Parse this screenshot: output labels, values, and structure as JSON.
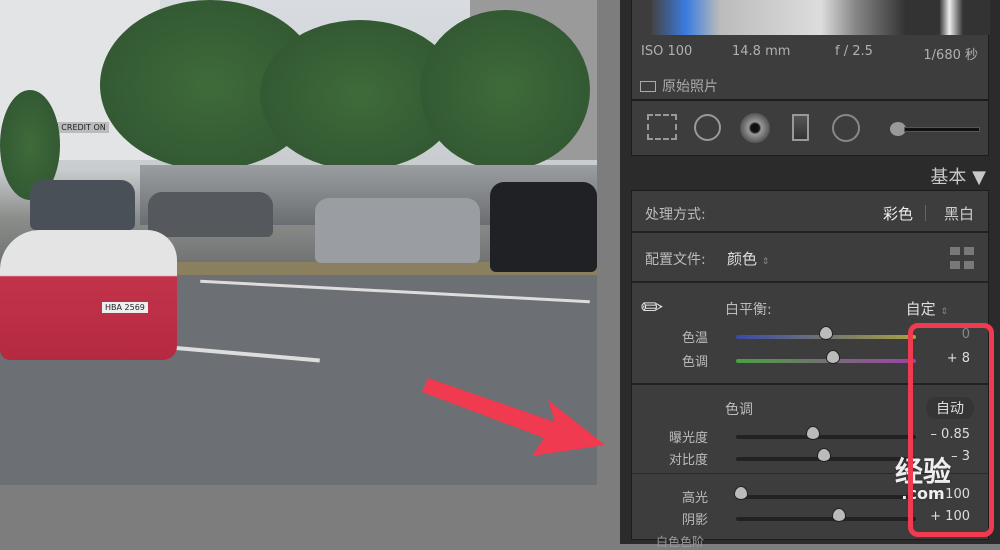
{
  "exif": {
    "iso": "ISO 100",
    "focal": "14.8 mm",
    "aperture": "f / 2.5",
    "shutter": "1/680 秒"
  },
  "original_photo_label": "原始照片",
  "section_title": "基本",
  "treatment": {
    "label": "处理方式:",
    "color": "彩色",
    "bw": "黑白"
  },
  "profile": {
    "label": "配置文件:",
    "value": "颜色"
  },
  "white_balance": {
    "label": "白平衡:",
    "value": "自定"
  },
  "sliders_wb": [
    {
      "label": "色温",
      "value": "0",
      "pos": 0.5
    },
    {
      "label": "色调",
      "value": "+ 8",
      "pos": 0.54
    }
  ],
  "tone": {
    "label": "色调",
    "auto": "自动"
  },
  "sliders_tone": [
    {
      "label": "曝光度",
      "value": "– 0.85",
      "pos": 0.43
    },
    {
      "label": "对比度",
      "value": "– 3",
      "pos": 0.49
    }
  ],
  "sliders_presence": [
    {
      "label": "高光",
      "value": "– 100",
      "pos": 0.0
    },
    {
      "label": "阴影",
      "value": "+ 100",
      "pos": 0.57
    }
  ],
  "next_slider_label": "白色色阶",
  "car_plate": "HBA 2569",
  "building_sign": "YAH CREDIT ON",
  "watermark": {
    "line1": "经验",
    "line2": ".com"
  },
  "accent": "#f03a4f"
}
